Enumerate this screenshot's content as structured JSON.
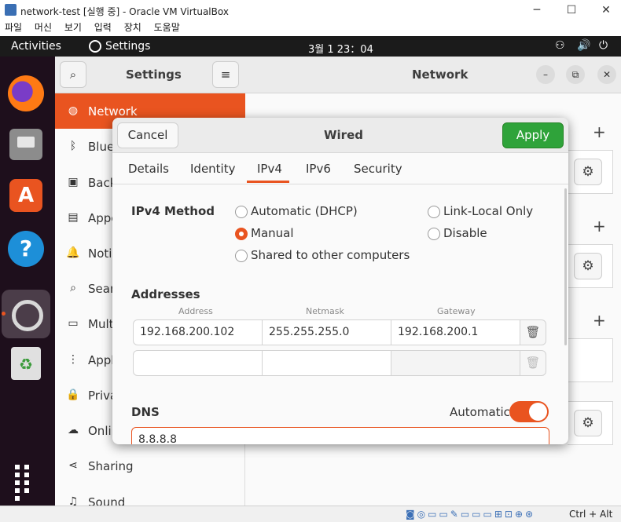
{
  "host_window": {
    "title": "network-test [실행 중] - Oracle VM VirtualBox",
    "controls": {
      "minimize": "─",
      "maximize": "☐",
      "close": "✕"
    },
    "menu": [
      "파일",
      "머신",
      "보기",
      "입력",
      "장치",
      "도움말"
    ]
  },
  "topbar": {
    "activities": "Activities",
    "app_label": "Settings",
    "clock": "3월 1  23：04",
    "tray": {
      "network": "⚇",
      "volume": "🔊",
      "power": "⏻"
    }
  },
  "dock": {
    "apps": [
      "firefox-icon",
      "files-icon",
      "software-icon",
      "help-icon",
      "settings-icon",
      "trash-icon"
    ],
    "help_glyph": "?",
    "store_glyph": "A",
    "trash_glyph": "♻"
  },
  "settings": {
    "sidebar_title": "Settings",
    "search_glyph": "⌕",
    "menu_glyph": "≡",
    "main_title": "Network",
    "main_controls": {
      "minimize": "–",
      "restore": "⧉",
      "close": "✕"
    },
    "sidebar_items": [
      {
        "label": "Network",
        "icon": "◍"
      },
      {
        "label": "Blue",
        "icon": "ᛒ"
      },
      {
        "label": "Back",
        "icon": "▣"
      },
      {
        "label": "Appe",
        "icon": "▤"
      },
      {
        "label": "Noti",
        "icon": "🔔"
      },
      {
        "label": "Sear",
        "icon": "⌕"
      },
      {
        "label": "Mult",
        "icon": "▭"
      },
      {
        "label": "Appl",
        "icon": "⋮"
      },
      {
        "label": "Priva",
        "icon": "🔒"
      },
      {
        "label": "Onlin",
        "icon": "☁"
      },
      {
        "label": "Sharing",
        "icon": "⋖"
      },
      {
        "label": "Sound",
        "icon": "♫"
      }
    ],
    "add_glyph": "+",
    "gear_glyph": "⚙"
  },
  "dialog": {
    "title": "Wired",
    "cancel": "Cancel",
    "apply": "Apply",
    "tabs": [
      "Details",
      "Identity",
      "IPv4",
      "IPv6",
      "Security"
    ],
    "active_tab": "IPv4",
    "ipv4_method_label": "IPv4 Method",
    "methods": {
      "automatic": "Automatic (DHCP)",
      "link_local": "Link-Local Only",
      "manual": "Manual",
      "disable": "Disable",
      "shared": "Shared to other computers"
    },
    "selected_method": "Manual",
    "addresses_label": "Addresses",
    "columns": {
      "address": "Address",
      "netmask": "Netmask",
      "gateway": "Gateway"
    },
    "rows": [
      {
        "address": "192.168.200.102",
        "netmask": "255.255.255.0",
        "gateway": "192.168.200.1"
      },
      {
        "address": "",
        "netmask": "",
        "gateway": ""
      }
    ],
    "delete_glyph": "🗑",
    "dns_label": "DNS",
    "dns_automatic_label": "Automatic",
    "dns_automatic_on": true,
    "dns_value": "8.8.8.8"
  },
  "statusbar": {
    "icons": "◙◎▭▭✎▭▭▭⊞⊡⊕⊛",
    "host_key": "Ctrl + Alt"
  },
  "colors": {
    "accent": "#e95420",
    "apply": "#2fa33a",
    "topbar": "#1b1b1b",
    "dock": "#1e0f1c"
  }
}
